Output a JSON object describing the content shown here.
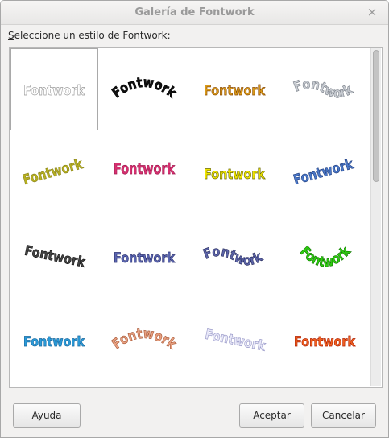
{
  "dialog": {
    "title": "Galería de Fontwork",
    "close_symbol": "×",
    "prompt": {
      "mnemonic": "S",
      "rest": "eleccione un estilo de Fontwork:"
    }
  },
  "gallery": {
    "item_text": "Fontwork",
    "selected_index": 0,
    "styles": [
      {
        "name": "outline-plain",
        "fill": "#ffffff",
        "stroke": "#9a9a9a",
        "shape": "flat"
      },
      {
        "name": "black-arch",
        "fill": "#111111",
        "stroke": "#000000",
        "shape": "arc-up"
      },
      {
        "name": "gold-gradient",
        "fill": "#d99a1a",
        "stroke": "#8a4a00",
        "shape": "flat"
      },
      {
        "name": "silver-3d",
        "fill": "#c8ccd2",
        "stroke": "#7d838c",
        "shape": "wave"
      },
      {
        "name": "olive-serif",
        "fill": "#b7b020",
        "stroke": "#8a8520",
        "shape": "rise"
      },
      {
        "name": "pink-perspective",
        "fill": "#d83070",
        "stroke": "#a01a50",
        "shape": "persp"
      },
      {
        "name": "yellow-3d",
        "fill": "#f0e500",
        "stroke": "#6a6a00",
        "shape": "flat"
      },
      {
        "name": "blue-slant",
        "fill": "#4a78c8",
        "stroke": "#223f80",
        "shape": "rise"
      },
      {
        "name": "grey-slant",
        "fill": "#444444",
        "stroke": "#111111",
        "shape": "slant"
      },
      {
        "name": "navy-gradient",
        "fill": "#5b66b0",
        "stroke": "#2a2f70",
        "shape": "flat"
      },
      {
        "name": "steel-3d",
        "fill": "#5c64a8",
        "stroke": "#2a2f60",
        "shape": "wave"
      },
      {
        "name": "green-circle",
        "fill": "#2ecc10",
        "stroke": "#117a00",
        "shape": "arc-down"
      },
      {
        "name": "cyan-plain",
        "fill": "#2a9ad8",
        "stroke": "#1a6aa0",
        "shape": "flat"
      },
      {
        "name": "salmon-arch",
        "fill": "#e8a080",
        "stroke": "#a85a3a",
        "shape": "arc-up"
      },
      {
        "name": "lavender-outline",
        "fill": "#e8e8f8",
        "stroke": "#9898c8",
        "shape": "slant"
      },
      {
        "name": "fire-gradient",
        "fill": "#f06020",
        "stroke": "#b02000",
        "shape": "flat"
      }
    ]
  },
  "buttons": {
    "help": "Ayuda",
    "ok": "Aceptar",
    "cancel": "Cancelar"
  }
}
